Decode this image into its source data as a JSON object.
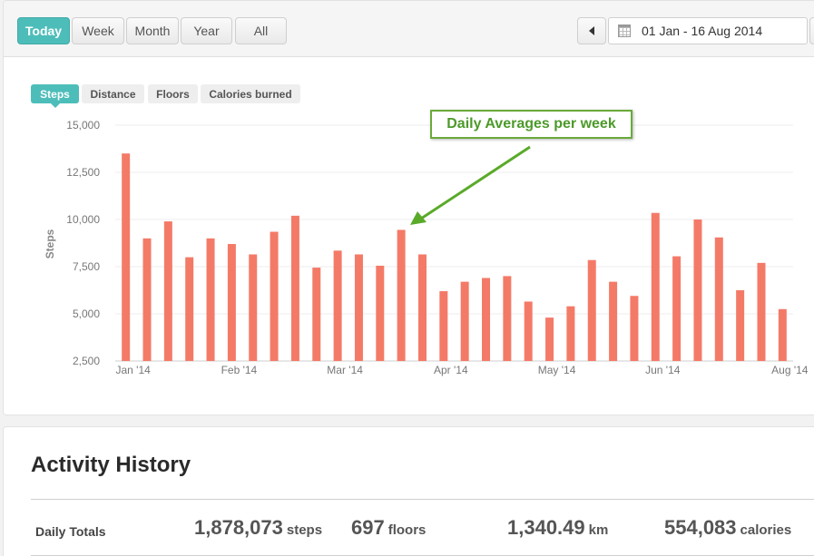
{
  "toolbar": {
    "ranges": [
      "Today",
      "Week",
      "Month",
      "Year",
      "All"
    ],
    "active_range": "Today",
    "date_range": "01 Jan - 16 Aug 2014"
  },
  "metric_tabs": [
    "Steps",
    "Distance",
    "Floors",
    "Calories burned"
  ],
  "active_metric": "Steps",
  "annotation": "Daily Averages per week",
  "colors": {
    "accent": "#4dbdba",
    "bar": "#f47a68",
    "callout": "#4c9a2a"
  },
  "chart_data": {
    "type": "bar",
    "ylabel": "Steps",
    "ylim": [
      2500,
      15000
    ],
    "yticks": [
      "2,500",
      "5,000",
      "7,500",
      "10,000",
      "12,500",
      "15,000"
    ],
    "xticks": [
      "Jan '14",
      "Feb '14",
      "Mar '14",
      "Apr '14",
      "May '14",
      "Jun '14",
      "Aug '14"
    ],
    "x_label_index": [
      0,
      5,
      10,
      15,
      20,
      25,
      31
    ],
    "grid": true,
    "values": [
      13500,
      9000,
      9900,
      8000,
      9000,
      8700,
      8150,
      9350,
      10200,
      7450,
      8350,
      8150,
      7550,
      9450,
      8150,
      6200,
      6700,
      6900,
      7000,
      5650,
      4800,
      5400,
      7850,
      6700,
      5950,
      10350,
      8050,
      10000,
      9050,
      6250,
      7700,
      5250
    ]
  },
  "history": {
    "title": "Activity History",
    "row_label": "Daily Totals",
    "stats": [
      {
        "value": "1,878,073",
        "unit": "steps"
      },
      {
        "value": "697",
        "unit": "floors"
      },
      {
        "value": "1,340.49",
        "unit": "km"
      },
      {
        "value": "554,083",
        "unit": "calories"
      }
    ]
  }
}
